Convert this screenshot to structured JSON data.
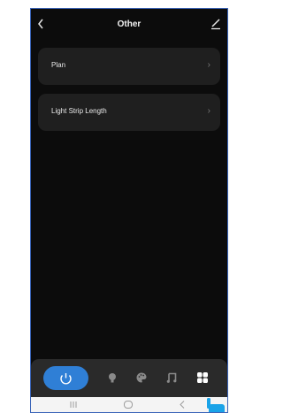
{
  "header": {
    "title": "Other"
  },
  "cards": [
    {
      "label": "Plan"
    },
    {
      "label": "Light Strip Length"
    }
  ],
  "nav": {
    "icons": [
      "power-icon",
      "bulb-icon",
      "palette-icon",
      "music-icon",
      "grid-icon"
    ],
    "active": "power-icon"
  },
  "system_nav": [
    "recent-apps-icon",
    "home-icon",
    "back-icon"
  ],
  "colors": {
    "accent": "#2f7fd6",
    "card": "#1f1f1f",
    "background": "#0c0c0c"
  }
}
